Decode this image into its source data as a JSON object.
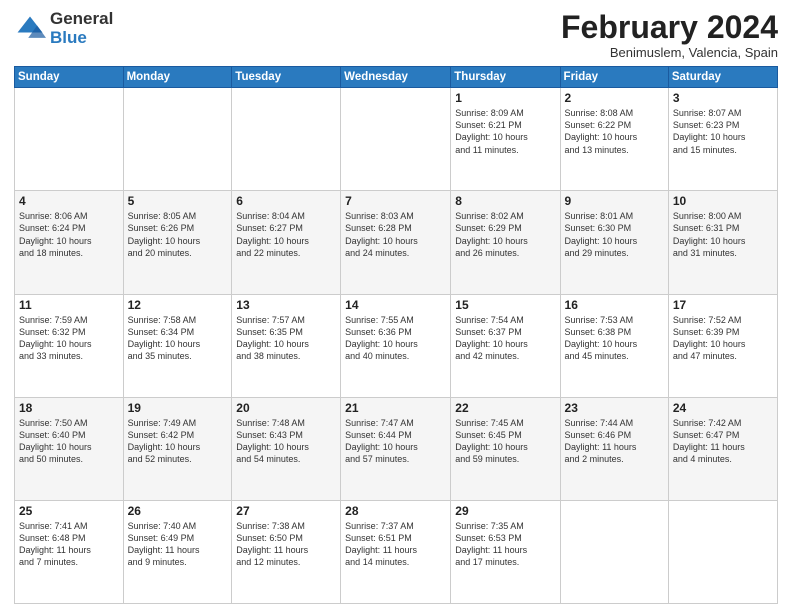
{
  "header": {
    "logo_general": "General",
    "logo_blue": "Blue",
    "month_title": "February 2024",
    "subtitle": "Benimuslem, Valencia, Spain"
  },
  "days_of_week": [
    "Sunday",
    "Monday",
    "Tuesday",
    "Wednesday",
    "Thursday",
    "Friday",
    "Saturday"
  ],
  "weeks": [
    [
      {
        "num": "",
        "info": ""
      },
      {
        "num": "",
        "info": ""
      },
      {
        "num": "",
        "info": ""
      },
      {
        "num": "",
        "info": ""
      },
      {
        "num": "1",
        "info": "Sunrise: 8:09 AM\nSunset: 6:21 PM\nDaylight: 10 hours\nand 11 minutes."
      },
      {
        "num": "2",
        "info": "Sunrise: 8:08 AM\nSunset: 6:22 PM\nDaylight: 10 hours\nand 13 minutes."
      },
      {
        "num": "3",
        "info": "Sunrise: 8:07 AM\nSunset: 6:23 PM\nDaylight: 10 hours\nand 15 minutes."
      }
    ],
    [
      {
        "num": "4",
        "info": "Sunrise: 8:06 AM\nSunset: 6:24 PM\nDaylight: 10 hours\nand 18 minutes."
      },
      {
        "num": "5",
        "info": "Sunrise: 8:05 AM\nSunset: 6:26 PM\nDaylight: 10 hours\nand 20 minutes."
      },
      {
        "num": "6",
        "info": "Sunrise: 8:04 AM\nSunset: 6:27 PM\nDaylight: 10 hours\nand 22 minutes."
      },
      {
        "num": "7",
        "info": "Sunrise: 8:03 AM\nSunset: 6:28 PM\nDaylight: 10 hours\nand 24 minutes."
      },
      {
        "num": "8",
        "info": "Sunrise: 8:02 AM\nSunset: 6:29 PM\nDaylight: 10 hours\nand 26 minutes."
      },
      {
        "num": "9",
        "info": "Sunrise: 8:01 AM\nSunset: 6:30 PM\nDaylight: 10 hours\nand 29 minutes."
      },
      {
        "num": "10",
        "info": "Sunrise: 8:00 AM\nSunset: 6:31 PM\nDaylight: 10 hours\nand 31 minutes."
      }
    ],
    [
      {
        "num": "11",
        "info": "Sunrise: 7:59 AM\nSunset: 6:32 PM\nDaylight: 10 hours\nand 33 minutes."
      },
      {
        "num": "12",
        "info": "Sunrise: 7:58 AM\nSunset: 6:34 PM\nDaylight: 10 hours\nand 35 minutes."
      },
      {
        "num": "13",
        "info": "Sunrise: 7:57 AM\nSunset: 6:35 PM\nDaylight: 10 hours\nand 38 minutes."
      },
      {
        "num": "14",
        "info": "Sunrise: 7:55 AM\nSunset: 6:36 PM\nDaylight: 10 hours\nand 40 minutes."
      },
      {
        "num": "15",
        "info": "Sunrise: 7:54 AM\nSunset: 6:37 PM\nDaylight: 10 hours\nand 42 minutes."
      },
      {
        "num": "16",
        "info": "Sunrise: 7:53 AM\nSunset: 6:38 PM\nDaylight: 10 hours\nand 45 minutes."
      },
      {
        "num": "17",
        "info": "Sunrise: 7:52 AM\nSunset: 6:39 PM\nDaylight: 10 hours\nand 47 minutes."
      }
    ],
    [
      {
        "num": "18",
        "info": "Sunrise: 7:50 AM\nSunset: 6:40 PM\nDaylight: 10 hours\nand 50 minutes."
      },
      {
        "num": "19",
        "info": "Sunrise: 7:49 AM\nSunset: 6:42 PM\nDaylight: 10 hours\nand 52 minutes."
      },
      {
        "num": "20",
        "info": "Sunrise: 7:48 AM\nSunset: 6:43 PM\nDaylight: 10 hours\nand 54 minutes."
      },
      {
        "num": "21",
        "info": "Sunrise: 7:47 AM\nSunset: 6:44 PM\nDaylight: 10 hours\nand 57 minutes."
      },
      {
        "num": "22",
        "info": "Sunrise: 7:45 AM\nSunset: 6:45 PM\nDaylight: 10 hours\nand 59 minutes."
      },
      {
        "num": "23",
        "info": "Sunrise: 7:44 AM\nSunset: 6:46 PM\nDaylight: 11 hours\nand 2 minutes."
      },
      {
        "num": "24",
        "info": "Sunrise: 7:42 AM\nSunset: 6:47 PM\nDaylight: 11 hours\nand 4 minutes."
      }
    ],
    [
      {
        "num": "25",
        "info": "Sunrise: 7:41 AM\nSunset: 6:48 PM\nDaylight: 11 hours\nand 7 minutes."
      },
      {
        "num": "26",
        "info": "Sunrise: 7:40 AM\nSunset: 6:49 PM\nDaylight: 11 hours\nand 9 minutes."
      },
      {
        "num": "27",
        "info": "Sunrise: 7:38 AM\nSunset: 6:50 PM\nDaylight: 11 hours\nand 12 minutes."
      },
      {
        "num": "28",
        "info": "Sunrise: 7:37 AM\nSunset: 6:51 PM\nDaylight: 11 hours\nand 14 minutes."
      },
      {
        "num": "29",
        "info": "Sunrise: 7:35 AM\nSunset: 6:53 PM\nDaylight: 11 hours\nand 17 minutes."
      },
      {
        "num": "",
        "info": ""
      },
      {
        "num": "",
        "info": ""
      }
    ]
  ]
}
